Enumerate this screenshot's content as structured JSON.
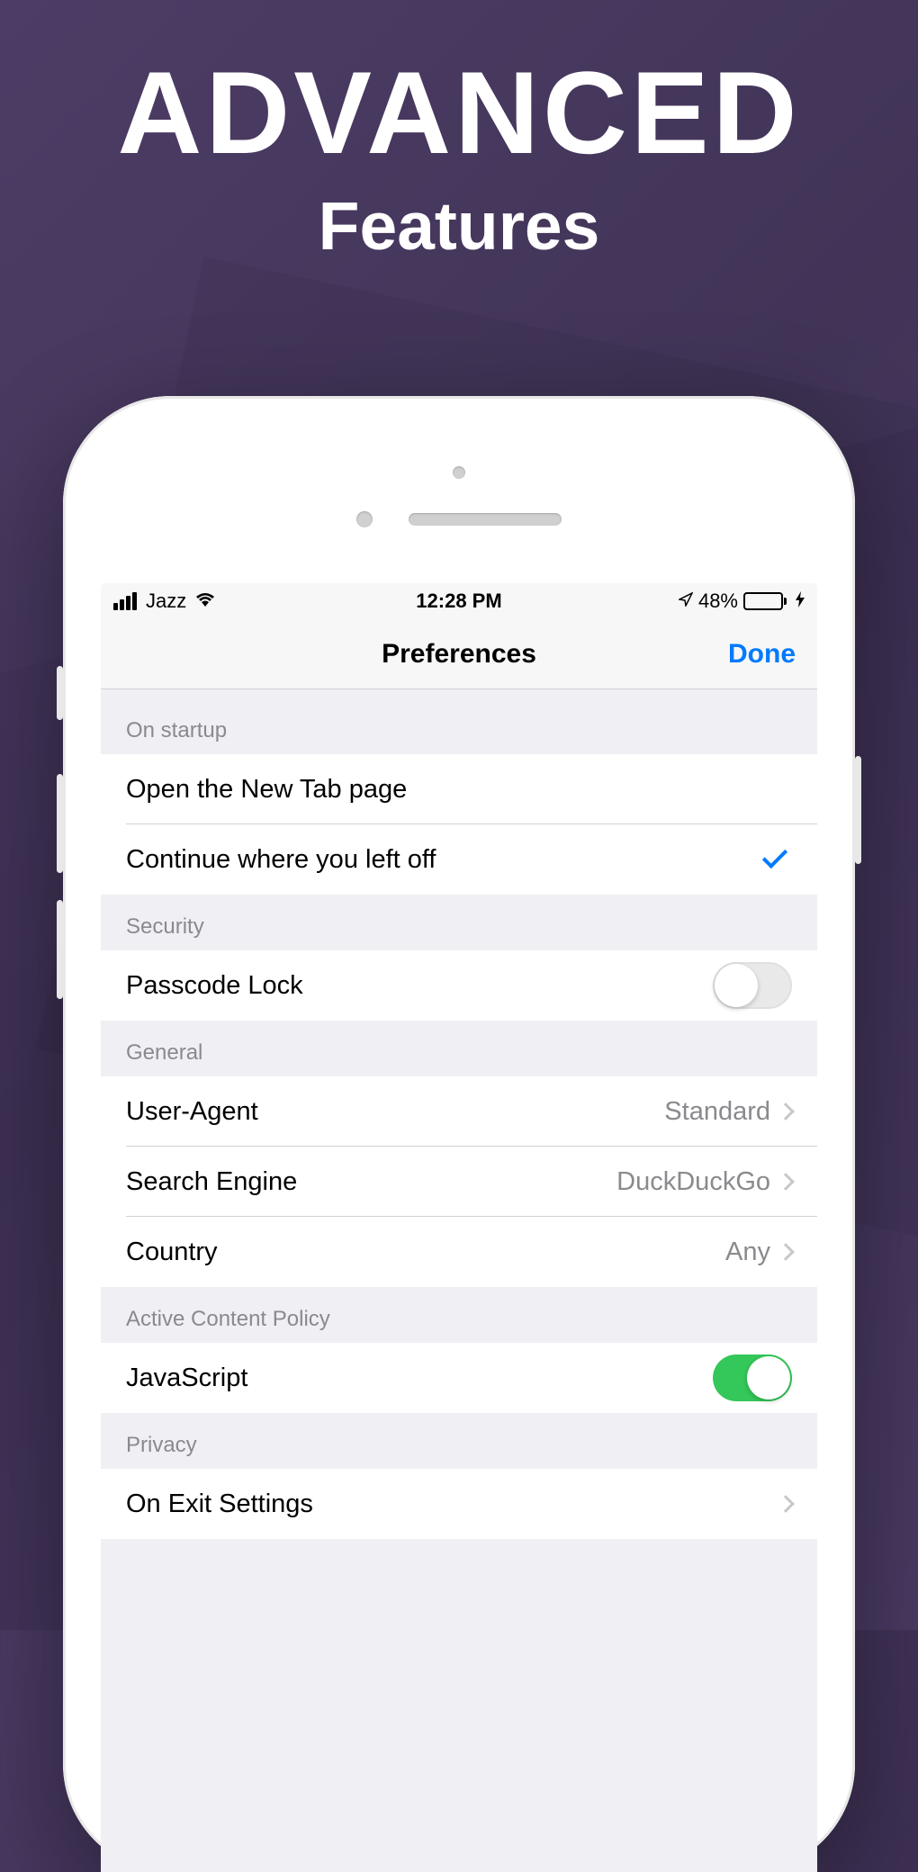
{
  "hero": {
    "title": "ADVANCED",
    "subtitle": "Features"
  },
  "status_bar": {
    "carrier": "Jazz",
    "time": "12:28 PM",
    "battery_percent": "48%"
  },
  "nav": {
    "title": "Preferences",
    "done": "Done"
  },
  "sections": {
    "startup": {
      "header": "On startup",
      "option_new_tab": "Open the New Tab page",
      "option_continue": "Continue where you left off"
    },
    "security": {
      "header": "Security",
      "passcode": "Passcode Lock",
      "passcode_enabled": false
    },
    "general": {
      "header": "General",
      "user_agent_label": "User-Agent",
      "user_agent_value": "Standard",
      "search_engine_label": "Search Engine",
      "search_engine_value": "DuckDuckGo",
      "country_label": "Country",
      "country_value": "Any"
    },
    "content_policy": {
      "header": "Active Content Policy",
      "javascript_label": "JavaScript",
      "javascript_enabled": true
    },
    "privacy": {
      "header": "Privacy",
      "on_exit_label": "On Exit Settings"
    }
  }
}
